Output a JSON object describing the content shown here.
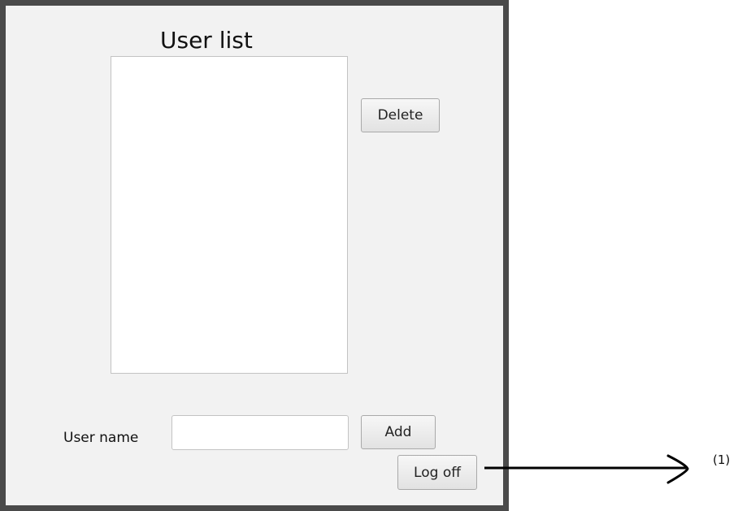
{
  "window": {
    "title": "User list"
  },
  "user_list": {
    "items": []
  },
  "actions": {
    "delete_label": "Delete",
    "add_label": "Add",
    "logoff_label": "Log off"
  },
  "form": {
    "username_label": "User name",
    "username_value": "",
    "username_placeholder": ""
  },
  "annotation": {
    "callout_label": "(1)"
  },
  "colors": {
    "window_border": "#4a4a4a",
    "window_background": "#f2f2f2",
    "arrow": "#000000"
  }
}
